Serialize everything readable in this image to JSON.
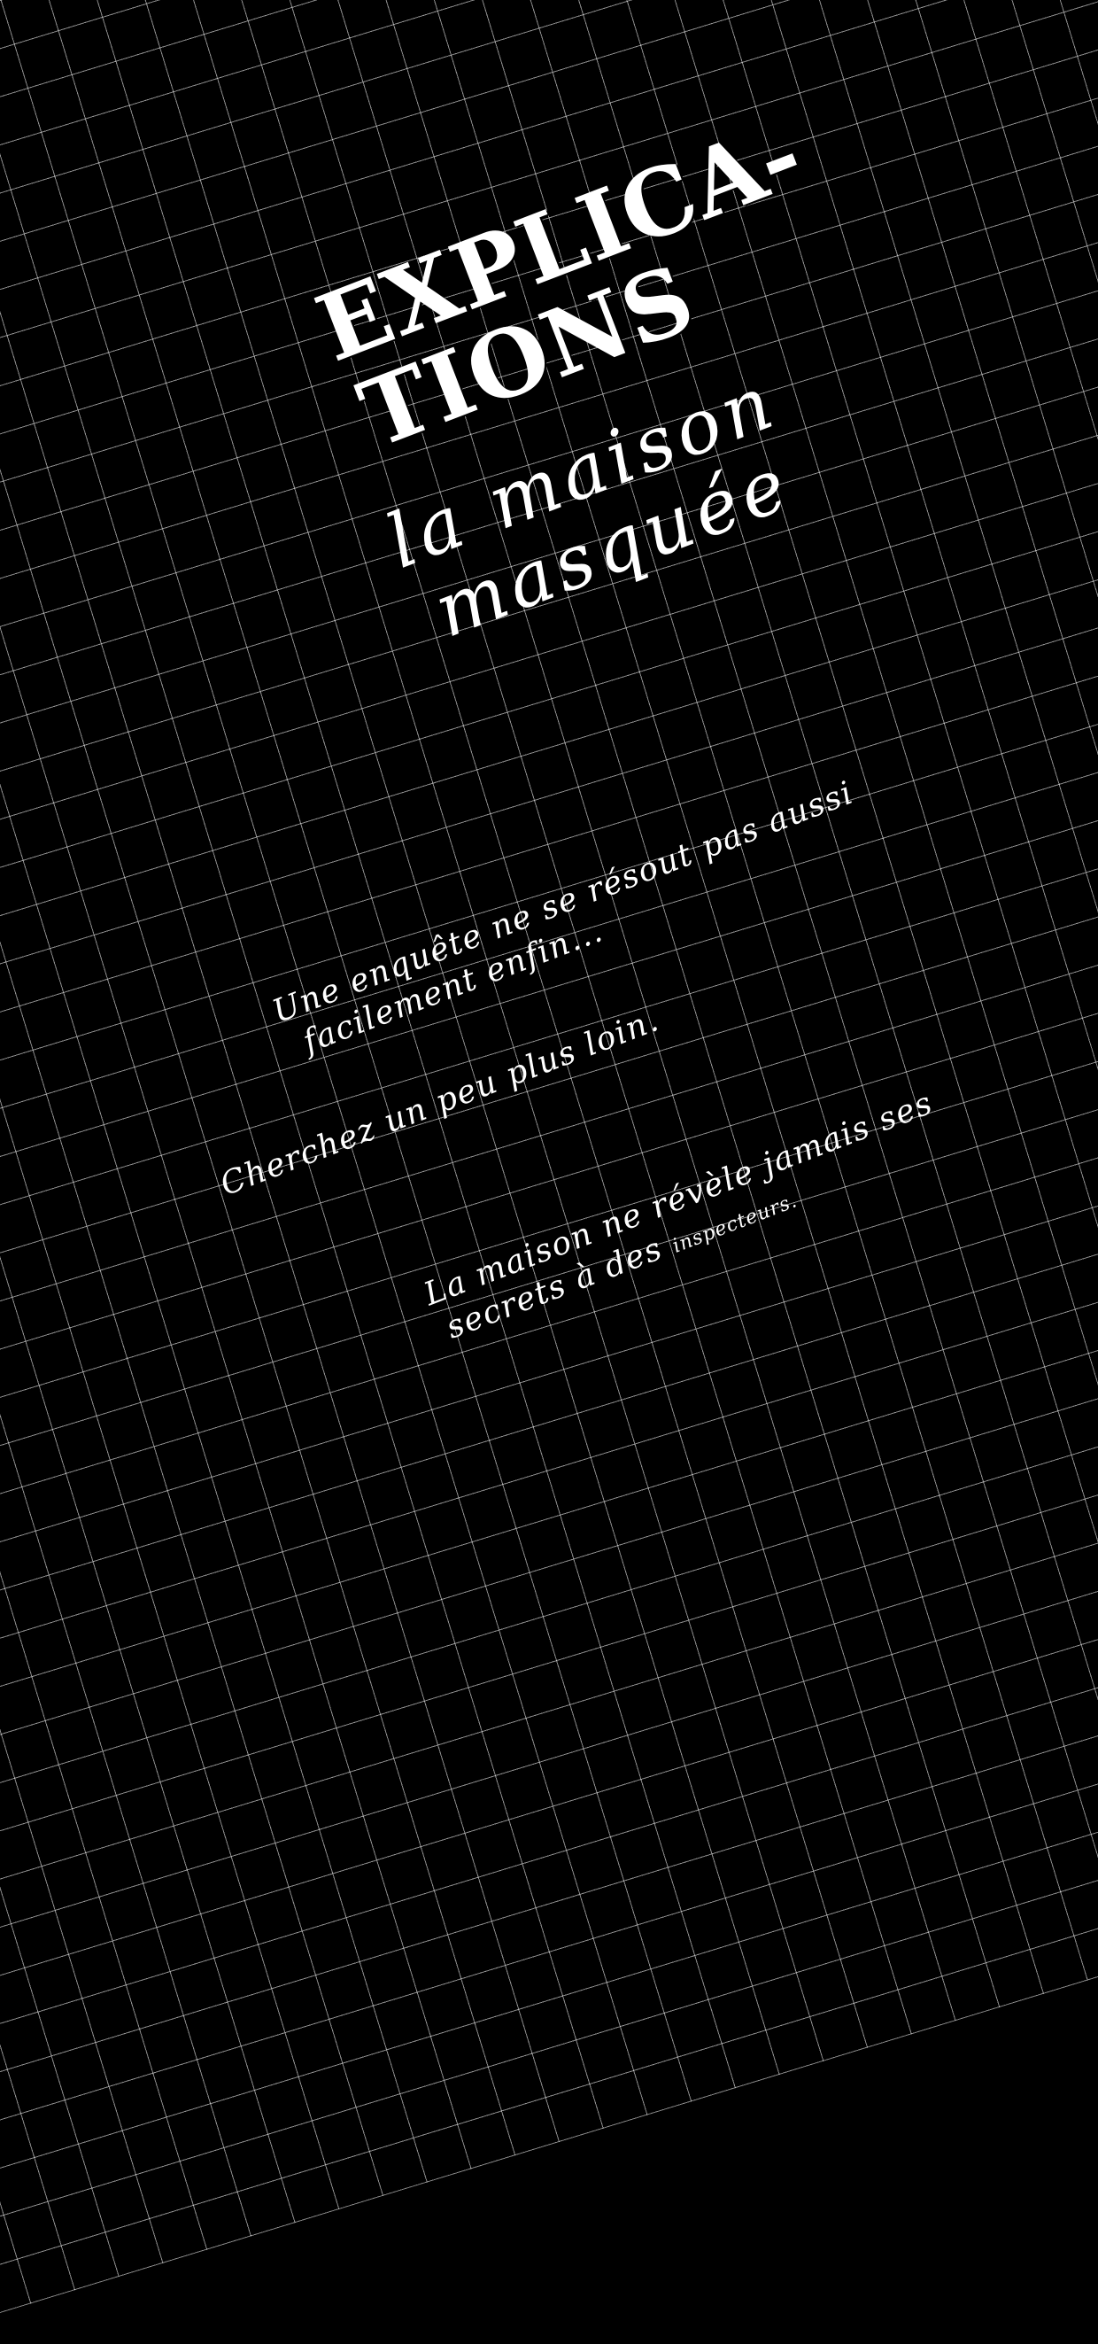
{
  "title": {
    "line1": "EXPLICA-",
    "line2": "TIONS"
  },
  "subtitle": {
    "line1": "la maison",
    "line2": "masquée"
  },
  "paragraphs": {
    "p1_line1": "Une enquête ne se résout pas aussi",
    "p1_line2": "facilement enfin...",
    "p2": "Cherchez un peu plus loin.",
    "p3_line1": "La maison ne révèle jamais ses",
    "p3_line2_a": "secrets à des ",
    "p3_line2_b": "inspecteurs."
  }
}
